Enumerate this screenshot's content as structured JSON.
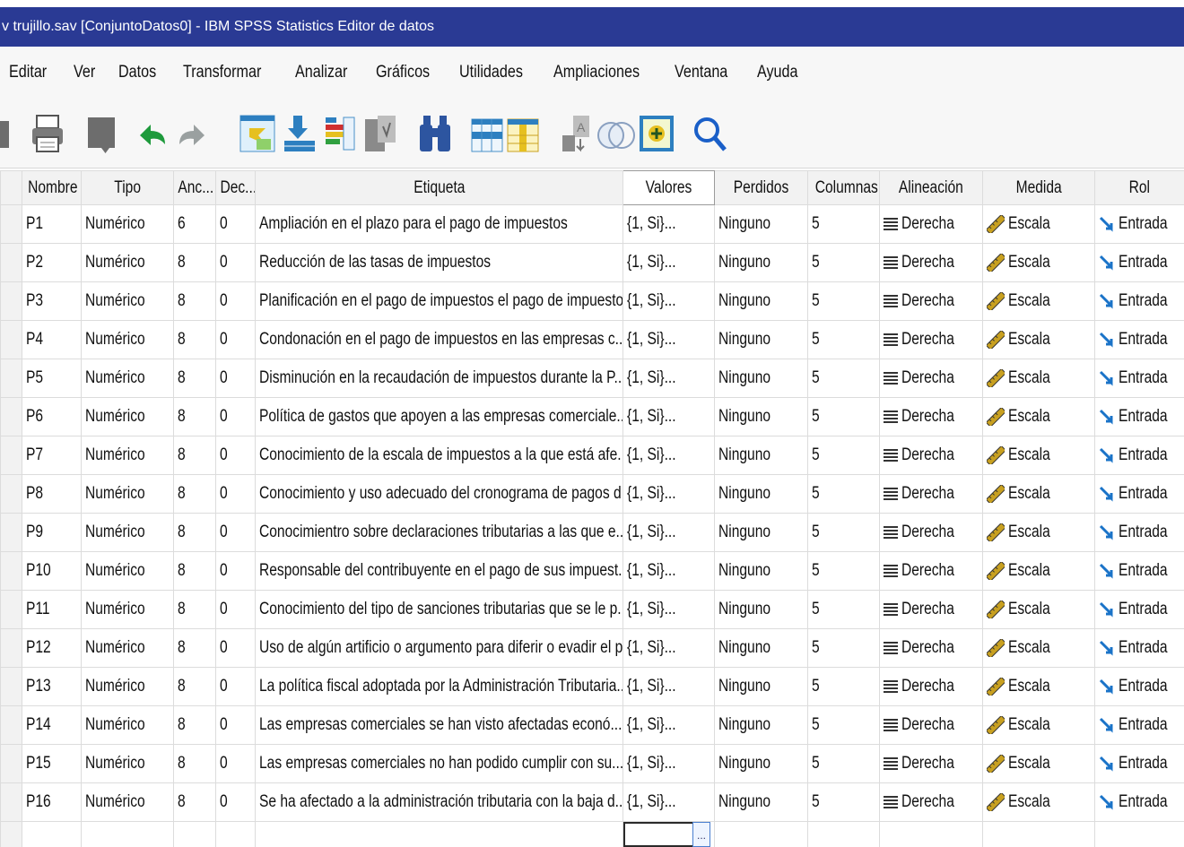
{
  "window": {
    "title": "v trujillo.sav [ConjuntoDatos0] - IBM SPSS Statistics Editor de datos"
  },
  "menu": [
    "Editar",
    "Ver",
    "Datos",
    "Transformar",
    "Analizar",
    "Gráficos",
    "Utilidades",
    "Ampliaciones",
    "Ventana",
    "Ayuda"
  ],
  "toolbar": {
    "icons": [
      "save-icon",
      "print-icon",
      "dialog-recall-icon",
      "undo-icon",
      "redo-icon",
      "goto-case-icon",
      "goto-variable-icon",
      "variables-icon",
      "run-descriptives-icon",
      "find-icon",
      "insert-cases-icon",
      "insert-variable-icon",
      "split-file-icon",
      "weight-cases-icon",
      "select-cases-icon",
      "value-labels-icon",
      "search-icon"
    ]
  },
  "columns": [
    "Nombre",
    "Tipo",
    "Anc...",
    "Dec...",
    "Etiqueta",
    "Valores",
    "Perdidos",
    "Columnas",
    "Alineación",
    "Medida",
    "Rol"
  ],
  "rows": [
    {
      "nombre": "P1",
      "tipo": "Numérico",
      "ancho": "6",
      "dec": "0",
      "etiqueta": "Ampliación en el plazo para el pago de impuestos",
      "valores": "{1, Si}...",
      "perdidos": "Ninguno",
      "columnas": "5",
      "alineacion": "Derecha",
      "medida": "Escala",
      "rol": "Entrada"
    },
    {
      "nombre": "P2",
      "tipo": "Numérico",
      "ancho": "8",
      "dec": "0",
      "etiqueta": "Reducción de las tasas de impuestos",
      "valores": "{1, Si}...",
      "perdidos": "Ninguno",
      "columnas": "5",
      "alineacion": "Derecha",
      "medida": "Escala",
      "rol": "Entrada"
    },
    {
      "nombre": "P3",
      "tipo": "Numérico",
      "ancho": "8",
      "dec": "0",
      "etiqueta": "Planificación en el pago de impuestos el pago de impuestos",
      "valores": "{1, Si}...",
      "perdidos": "Ninguno",
      "columnas": "5",
      "alineacion": "Derecha",
      "medida": "Escala",
      "rol": "Entrada"
    },
    {
      "nombre": "P4",
      "tipo": "Numérico",
      "ancho": "8",
      "dec": "0",
      "etiqueta": "Condonación en el pago de impuestos en las empresas c...",
      "valores": "{1, Si}...",
      "perdidos": "Ninguno",
      "columnas": "5",
      "alineacion": "Derecha",
      "medida": "Escala",
      "rol": "Entrada"
    },
    {
      "nombre": "P5",
      "tipo": "Numérico",
      "ancho": "8",
      "dec": "0",
      "etiqueta": "Disminución en la recaudación de impuestos durante la P...",
      "valores": "{1, Si}...",
      "perdidos": "Ninguno",
      "columnas": "5",
      "alineacion": "Derecha",
      "medida": "Escala",
      "rol": "Entrada"
    },
    {
      "nombre": "P6",
      "tipo": "Numérico",
      "ancho": "8",
      "dec": "0",
      "etiqueta": "Política de gastos que apoyen a las empresas comerciale...",
      "valores": "{1, Si}...",
      "perdidos": "Ninguno",
      "columnas": "5",
      "alineacion": "Derecha",
      "medida": "Escala",
      "rol": "Entrada"
    },
    {
      "nombre": "P7",
      "tipo": "Numérico",
      "ancho": "8",
      "dec": "0",
      "etiqueta": "Conocimiento de la escala de impuestos a la que está afe...",
      "valores": "{1, Si}...",
      "perdidos": "Ninguno",
      "columnas": "5",
      "alineacion": "Derecha",
      "medida": "Escala",
      "rol": "Entrada"
    },
    {
      "nombre": "P8",
      "tipo": "Numérico",
      "ancho": "8",
      "dec": "0",
      "etiqueta": "Conocimiento y uso adecuado del cronograma de pagos d...",
      "valores": "{1, Si}...",
      "perdidos": "Ninguno",
      "columnas": "5",
      "alineacion": "Derecha",
      "medida": "Escala",
      "rol": "Entrada"
    },
    {
      "nombre": "P9",
      "tipo": "Numérico",
      "ancho": "8",
      "dec": "0",
      "etiqueta": "Conocimientro sobre declaraciones tributarias a las que e...",
      "valores": "{1, Si}...",
      "perdidos": "Ninguno",
      "columnas": "5",
      "alineacion": "Derecha",
      "medida": "Escala",
      "rol": "Entrada"
    },
    {
      "nombre": "P10",
      "tipo": "Numérico",
      "ancho": "8",
      "dec": "0",
      "etiqueta": "Responsable del contribuyente en el pago de sus impuest...",
      "valores": "{1, Si}...",
      "perdidos": "Ninguno",
      "columnas": "5",
      "alineacion": "Derecha",
      "medida": "Escala",
      "rol": "Entrada"
    },
    {
      "nombre": "P11",
      "tipo": "Numérico",
      "ancho": "8",
      "dec": "0",
      "etiqueta": "Conocimiento del tipo de sanciones tributarias que se le p...",
      "valores": "{1, Si}...",
      "perdidos": "Ninguno",
      "columnas": "5",
      "alineacion": "Derecha",
      "medida": "Escala",
      "rol": "Entrada"
    },
    {
      "nombre": "P12",
      "tipo": "Numérico",
      "ancho": "8",
      "dec": "0",
      "etiqueta": "Uso de algún artificio o argumento para diferir o evadir el p...",
      "valores": "{1, Si}...",
      "perdidos": "Ninguno",
      "columnas": "5",
      "alineacion": "Derecha",
      "medida": "Escala",
      "rol": "Entrada"
    },
    {
      "nombre": "P13",
      "tipo": "Numérico",
      "ancho": "8",
      "dec": "0",
      "etiqueta": "La política fiscal adoptada por la Administración Tributaria...",
      "valores": "{1, Si}...",
      "perdidos": "Ninguno",
      "columnas": "5",
      "alineacion": "Derecha",
      "medida": "Escala",
      "rol": "Entrada"
    },
    {
      "nombre": "P14",
      "tipo": "Numérico",
      "ancho": "8",
      "dec": "0",
      "etiqueta": "Las empresas comerciales se han visto afectadas econó...",
      "valores": "{1, Si}...",
      "perdidos": "Ninguno",
      "columnas": "5",
      "alineacion": "Derecha",
      "medida": "Escala",
      "rol": "Entrada"
    },
    {
      "nombre": "P15",
      "tipo": "Numérico",
      "ancho": "8",
      "dec": "0",
      "etiqueta": "Las empresas comerciales no han podido cumplir con su...",
      "valores": "{1, Si}...",
      "perdidos": "Ninguno",
      "columnas": "5",
      "alineacion": "Derecha",
      "medida": "Escala",
      "rol": "Entrada"
    },
    {
      "nombre": "P16",
      "tipo": "Numérico",
      "ancho": "8",
      "dec": "0",
      "etiqueta": "Se ha afectado a la administración tributaria con la baja d...",
      "valores": "{1, Si}...",
      "perdidos": "Ninguno",
      "columnas": "5",
      "alineacion": "Derecha",
      "medida": "Escala",
      "rol": "Entrada"
    }
  ],
  "new_row_cell_button": "...",
  "colors": {
    "titlebar": "#2a3a94",
    "medida_icon": "#c8a020",
    "rol_icon": "#1a73c8"
  }
}
